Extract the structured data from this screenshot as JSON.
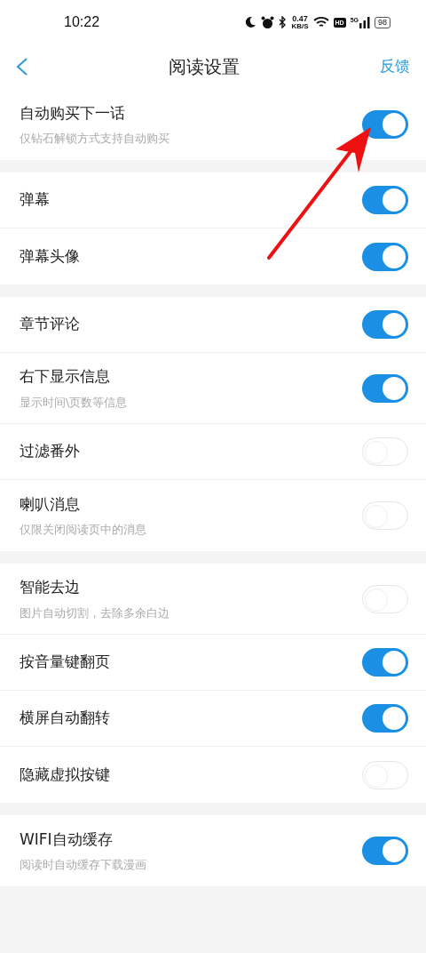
{
  "status_bar": {
    "time": "10:22",
    "net_speed": "0.47",
    "net_unit": "KB/S",
    "hd": "HD",
    "network": "5G",
    "battery": "98"
  },
  "header": {
    "title": "阅读设置",
    "action": "反馈"
  },
  "groups": [
    {
      "items": [
        {
          "label": "自动购买下一话",
          "hint": "仅钻石解锁方式支持自动购买",
          "on": true
        }
      ]
    },
    {
      "items": [
        {
          "label": "弹幕",
          "on": true
        },
        {
          "label": "弹幕头像",
          "on": true
        }
      ]
    },
    {
      "items": [
        {
          "label": "章节评论",
          "on": true
        },
        {
          "label": "右下显示信息",
          "hint": "显示时间\\页数等信息",
          "on": true
        },
        {
          "label": "过滤番外",
          "on": false
        },
        {
          "label": "喇叭消息",
          "hint": "仅限关闭阅读页中的消息",
          "on": false
        }
      ]
    },
    {
      "items": [
        {
          "label": "智能去边",
          "hint": "图片自动切割，去除多余白边",
          "on": false
        },
        {
          "label": "按音量键翻页",
          "on": true
        },
        {
          "label": "横屏自动翻转",
          "on": true
        },
        {
          "label": "隐藏虚拟按键",
          "on": false
        }
      ]
    },
    {
      "items": [
        {
          "label": "WIFI自动缓存",
          "hint": "阅读时自动缓存下载漫画",
          "on": true
        }
      ]
    }
  ],
  "annotation": {
    "kind": "arrow"
  }
}
